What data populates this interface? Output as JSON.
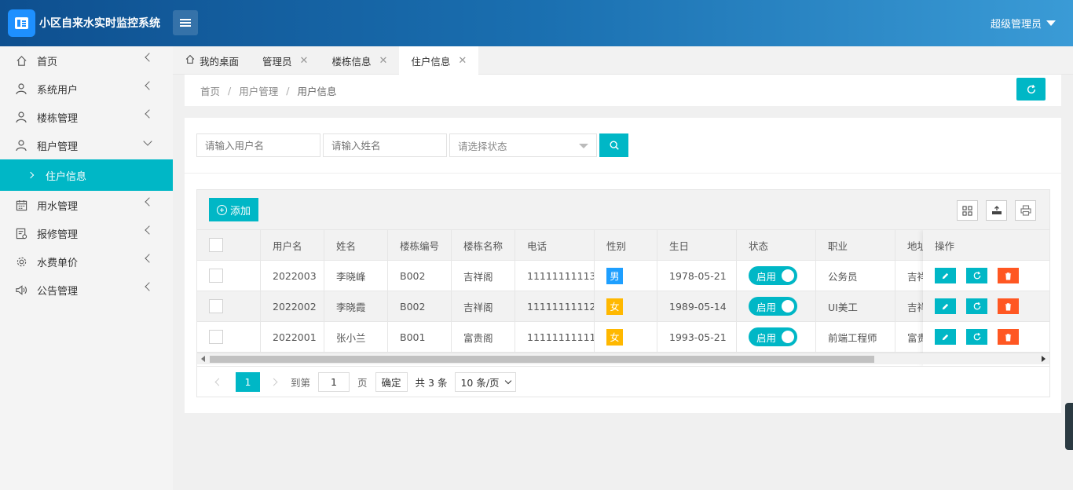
{
  "header": {
    "app_title": "小区自来水实时监控系统",
    "user": "超级管理员"
  },
  "sidebar": {
    "items": [
      {
        "label": "首页",
        "icon": "home-icon"
      },
      {
        "label": "系统用户",
        "icon": "users-icon"
      },
      {
        "label": "楼栋管理",
        "icon": "user-icon"
      },
      {
        "label": "租户管理",
        "icon": "user-icon",
        "expanded": true
      },
      {
        "label": "住户信息",
        "active": true
      },
      {
        "label": "用水管理",
        "icon": "calendar-icon"
      },
      {
        "label": "报修管理",
        "icon": "form-icon"
      },
      {
        "label": "水费单价",
        "icon": "gear-icon"
      },
      {
        "label": "公告管理",
        "icon": "speaker-icon"
      }
    ]
  },
  "tabs": [
    {
      "label": "我的桌面",
      "icon": "home-icon"
    },
    {
      "label": "管理员"
    },
    {
      "label": "楼栋信息"
    },
    {
      "label": "住户信息",
      "active": true
    }
  ],
  "breadcrumb": [
    "首页",
    "用户管理",
    "用户信息"
  ],
  "search": {
    "username_placeholder": "请输入用户名",
    "name_placeholder": "请输入姓名",
    "status_placeholder": "请选择状态"
  },
  "toolbar": {
    "add_label": "添加"
  },
  "table": {
    "columns": [
      "用户名",
      "姓名",
      "楼栋编号",
      "楼栋名称",
      "电话",
      "性别",
      "生日",
      "状态",
      "职业",
      "地址"
    ],
    "ops_header": "操作",
    "rows": [
      {
        "username": "2022003",
        "name": "李晓峰",
        "building_no": "B002",
        "building_name": "吉祥阁",
        "phone": "11111111113",
        "gender": "男",
        "birthday": "1978-05-21",
        "status": "启用",
        "job": "公务员",
        "address": "吉祥"
      },
      {
        "username": "2022002",
        "name": "李晓霞",
        "building_no": "B002",
        "building_name": "吉祥阁",
        "phone": "11111111112",
        "gender": "女",
        "birthday": "1989-05-14",
        "status": "启用",
        "job": "UI美工",
        "address": "吉祥"
      },
      {
        "username": "2022001",
        "name": "张小兰",
        "building_no": "B001",
        "building_name": "富贵阁",
        "phone": "11111111111",
        "gender": "女",
        "birthday": "1993-05-21",
        "status": "启用",
        "job": "前端工程师",
        "address": "富贵"
      }
    ]
  },
  "pager": {
    "current": "1",
    "goto_label": "到第",
    "page_input": "1",
    "page_unit": "页",
    "ok_label": "确定",
    "total": "共 3 条",
    "page_size": "10 条/页"
  },
  "colors": {
    "accent": "#00b7c6",
    "danger": "#ff5722",
    "male": "#1e9fff",
    "female": "#ffb800"
  }
}
